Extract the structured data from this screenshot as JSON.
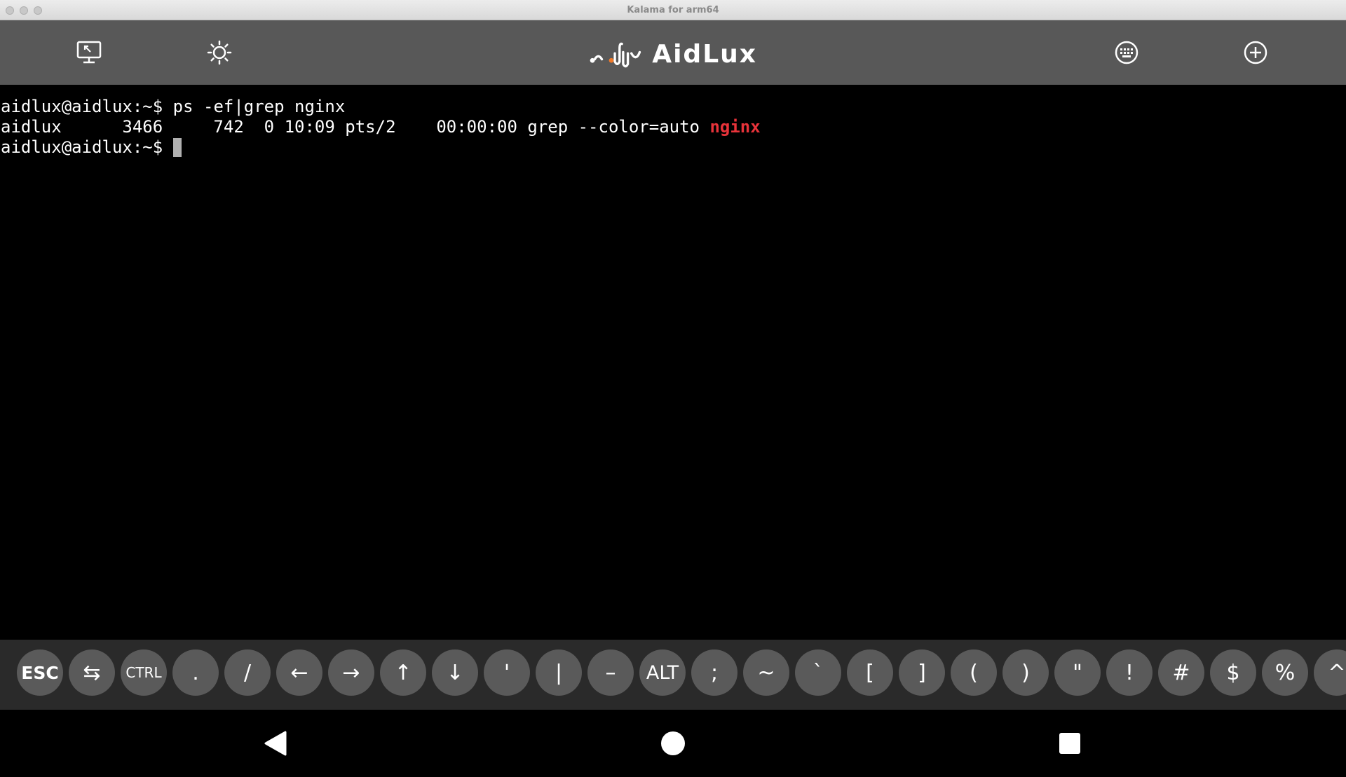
{
  "window": {
    "title": "Kalama for arm64"
  },
  "header": {
    "logo_text": "AidLux",
    "icons": [
      "desktop-icon",
      "brightness-icon",
      "keyboard-icon",
      "add-circle-icon"
    ]
  },
  "terminal": {
    "lines": [
      {
        "prompt": "aidlux@aidlux:~$ ",
        "text": "ps -ef|grep nginx",
        "highlight": ""
      },
      {
        "prompt": "",
        "text": "aidlux      3466     742  0 10:09 pts/2    00:00:00 grep --color=auto ",
        "highlight": "nginx"
      },
      {
        "prompt": "aidlux@aidlux:~$ ",
        "text": "",
        "highlight": ""
      }
    ],
    "highlight_color": "#e8333a"
  },
  "keys": [
    {
      "label": "ESC",
      "name": "esc"
    },
    {
      "label": "⇆",
      "name": "tab"
    },
    {
      "label": "CTRL",
      "name": "ctrl"
    },
    {
      "label": ".",
      "name": "period"
    },
    {
      "label": "/",
      "name": "slash"
    },
    {
      "label": "←",
      "name": "arrow-left"
    },
    {
      "label": "→",
      "name": "arrow-right"
    },
    {
      "label": "↑",
      "name": "arrow-up"
    },
    {
      "label": "↓",
      "name": "arrow-down"
    },
    {
      "label": "'",
      "name": "apostrophe"
    },
    {
      "label": "|",
      "name": "pipe"
    },
    {
      "label": "–",
      "name": "dash"
    },
    {
      "label": "ALT",
      "name": "alt"
    },
    {
      "label": ";",
      "name": "semicolon"
    },
    {
      "label": "~",
      "name": "tilde"
    },
    {
      "label": "`",
      "name": "backtick"
    },
    {
      "label": "[",
      "name": "left-bracket"
    },
    {
      "label": "]",
      "name": "right-bracket"
    },
    {
      "label": "(",
      "name": "left-paren"
    },
    {
      "label": ")",
      "name": "right-paren"
    },
    {
      "label": "\"",
      "name": "double-quote"
    },
    {
      "label": "!",
      "name": "exclamation"
    },
    {
      "label": "#",
      "name": "hash"
    },
    {
      "label": "$",
      "name": "dollar"
    },
    {
      "label": "%",
      "name": "percent"
    },
    {
      "label": "^",
      "name": "caret"
    }
  ],
  "navbar": {
    "icons": [
      "back-icon",
      "home-icon",
      "recents-icon"
    ]
  }
}
